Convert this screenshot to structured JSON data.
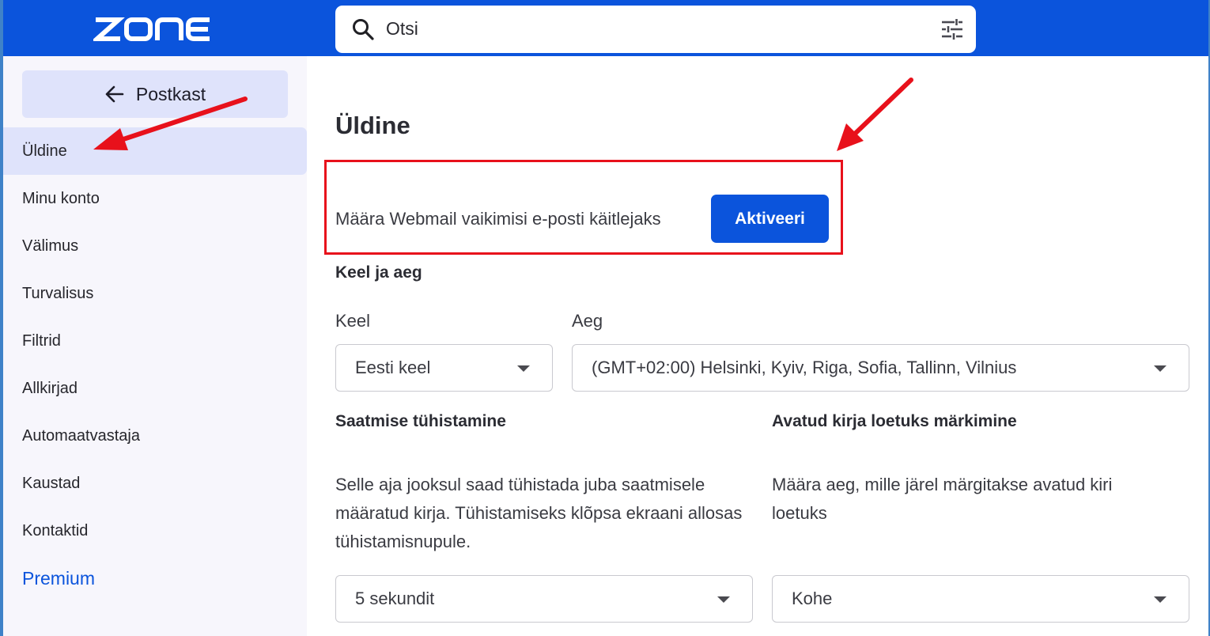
{
  "header": {
    "logo_text": "ZONE",
    "search_placeholder": "Otsi",
    "brand_color": "#0b54dc",
    "icons": [
      "search-icon",
      "filter-sliders-icon"
    ]
  },
  "sidebar": {
    "back_label": "Postkast",
    "items": [
      {
        "label": "Üldine",
        "active": true
      },
      {
        "label": "Minu konto"
      },
      {
        "label": "Välimus"
      },
      {
        "label": "Turvalisus"
      },
      {
        "label": "Filtrid"
      },
      {
        "label": "Allkirjad"
      },
      {
        "label": "Automaatvastaja"
      },
      {
        "label": "Kaustad"
      },
      {
        "label": "Kontaktid"
      },
      {
        "label": "Premium",
        "highlight": true
      }
    ]
  },
  "main": {
    "title": "Üldine",
    "default_handler": {
      "text": "Määra Webmail vaikimisi e-posti käitlejaks",
      "button_label": "Aktiveeri"
    },
    "language_time": {
      "heading": "Keel ja aeg",
      "language_label": "Keel",
      "language_value": "Eesti keel",
      "time_label": "Aeg",
      "time_value": "(GMT+02:00) Helsinki, Kyiv, Riga, Sofia, Tallinn, Vilnius"
    },
    "undo_send": {
      "heading": "Saatmise tühistamine",
      "description": "Selle aja jooksul saad tühistada juba saatmisele määratud kirja. Tühistamiseks klõpsa ekraani allosas tühistamisnupule.",
      "value": "5 sekundit"
    },
    "mark_read": {
      "heading": "Avatud kirja loetuks märkimine",
      "description": "Määra aeg, mille järel märgitakse avatud kiri loetuks",
      "value": "Kohe"
    }
  },
  "annotations": {
    "arrow_color": "#e8111b"
  }
}
